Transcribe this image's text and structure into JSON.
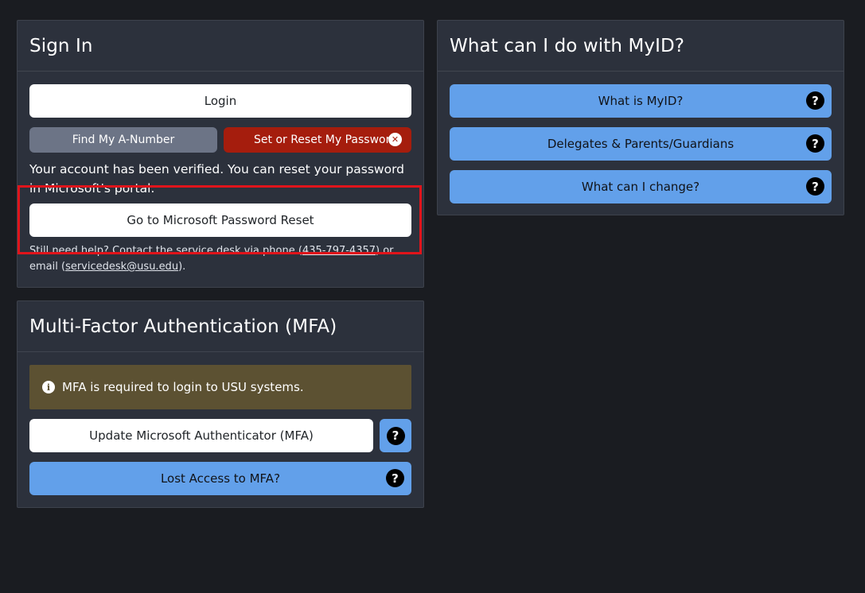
{
  "signin": {
    "title": "Sign In",
    "login_label": "Login",
    "find_anumber_label": "Find My A-Number",
    "reset_password_label": "Set or Reset My Password",
    "verified_message": "Your account has been verified. You can reset your password in Microsoft's portal.",
    "ms_reset_label": "Go to Microsoft Password Reset",
    "help_prefix": "Still need help? Contact the service desk via phone (",
    "help_phone": "435-797-4357",
    "help_middle": ") or email (",
    "help_email": "servicedesk@usu.edu",
    "help_suffix": ")."
  },
  "mfa": {
    "title": "Multi-Factor Authentication (MFA)",
    "alert_text": "MFA is required to login to USU systems.",
    "update_label": "Update Microsoft Authenticator (MFA)",
    "lost_label": "Lost Access to MFA?"
  },
  "myid": {
    "title": "What can I do with MyID?",
    "items": [
      {
        "label": "What is MyID?"
      },
      {
        "label": "Delegates & Parents/Guardians"
      },
      {
        "label": "What can I change?"
      }
    ]
  },
  "icons": {
    "help": "?",
    "close": "✕",
    "info": "i"
  },
  "colors": {
    "background": "#1a1c21",
    "card": "#2c313c",
    "primary_blue": "#62a0ea",
    "danger_red": "#a51d0d",
    "secondary_gray": "#6c7486",
    "alert_bg": "#5c5132",
    "highlight": "#e0141b"
  }
}
